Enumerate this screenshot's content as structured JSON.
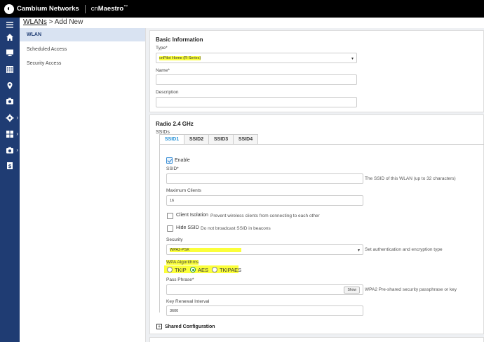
{
  "topbar": {
    "brand": "Cambium Networks",
    "product_prefix": "cn",
    "product_name": "Maestro",
    "trademark": "™"
  },
  "breadcrumb": {
    "link": "WLANs",
    "separator": " > ",
    "current": "Add New"
  },
  "subnav": [
    {
      "label": "WLAN"
    },
    {
      "label": "Scheduled Access"
    },
    {
      "label": "Security Access"
    }
  ],
  "basic": {
    "title": "Basic Information",
    "type_label": "Type*",
    "type_value": "cnPilot Home (R-Series)",
    "name_label": "Name*",
    "name_value": "",
    "description_label": "Description",
    "description_value": ""
  },
  "radio": {
    "title": "Radio 2.4 GHz",
    "ssids_label": "SSIDs",
    "tabs": [
      "SSID1",
      "SSID2",
      "SSID3",
      "SSID4"
    ],
    "enable_label": "Enable",
    "ssid_label": "SSID*",
    "ssid_value": "",
    "ssid_hint": "The SSID of this WLAN (up to 32 characters)",
    "max_clients_label": "Maximum Clients",
    "max_clients_value": "16",
    "client_isolation_label": "Client Isolation",
    "client_isolation_hint": "Prevent wireless clients from connecting to each other",
    "hide_ssid_label": "Hide SSID",
    "hide_ssid_hint": "Do not broadcast SSID in beacons",
    "security_label": "Security",
    "security_value": "WPA2-PSK",
    "security_hint": "Set authentication and encryption type",
    "wpa_label": "WPA Algorithms",
    "wpa_options": [
      "TKIP",
      "AES",
      "TKIPAES"
    ],
    "passphrase_label": "Pass Phrase*",
    "passphrase_value": "",
    "show_label": "Show",
    "passphrase_hint": "WPA2 Pre-shared security passphrase or key",
    "key_renewal_label": "Key Renewal Interval",
    "key_renewal_value": "3600"
  },
  "shared": {
    "label": "Shared Configuration"
  }
}
